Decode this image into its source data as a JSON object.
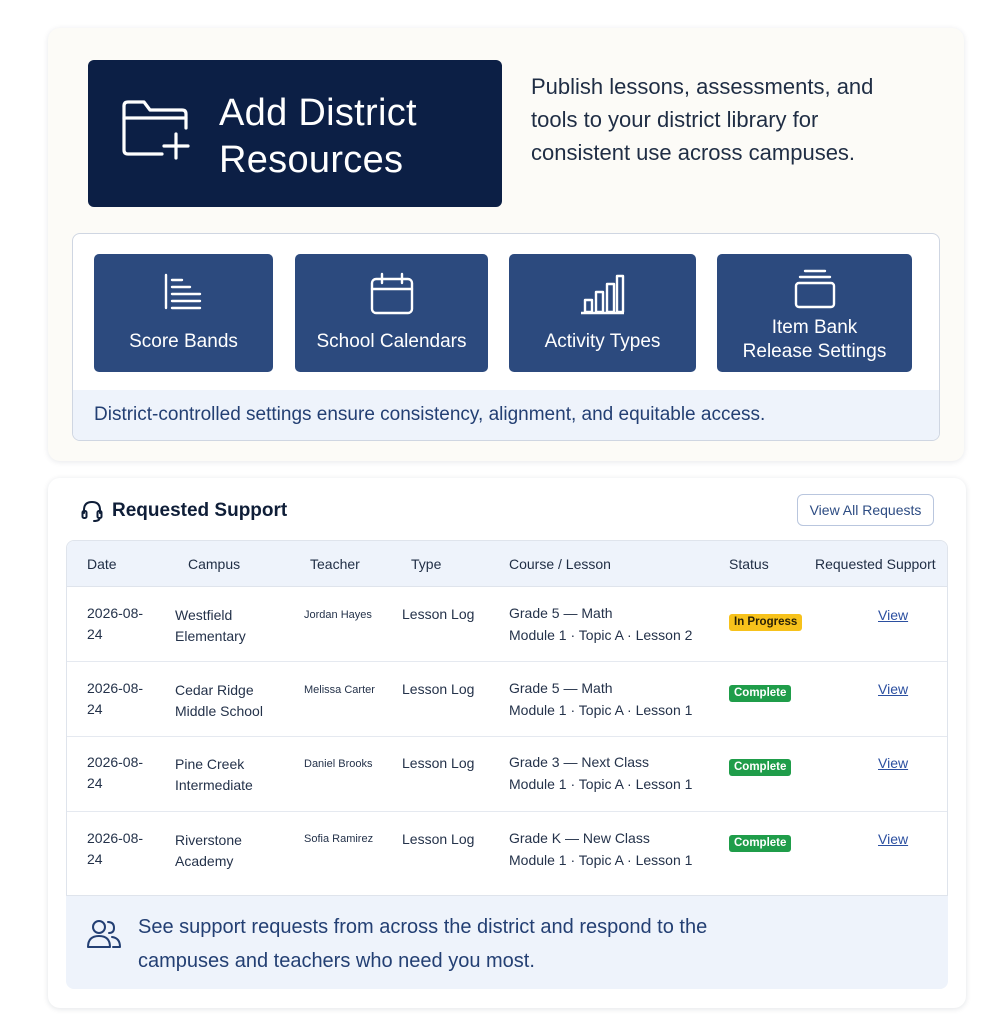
{
  "hero": {
    "title": "Add District Resources",
    "description": "Publish lessons, assessments, and tools to your district library for consistent use across campuses."
  },
  "settings": {
    "tiles": [
      {
        "label": "Score Bands",
        "icon": "list-bars-icon"
      },
      {
        "label": "School Calendars",
        "icon": "calendar-icon"
      },
      {
        "label": "Activity Types",
        "icon": "bar-chart-icon"
      },
      {
        "label": "Item Bank Release Settings",
        "icon": "stack-box-icon"
      }
    ],
    "footer": "District-controlled settings ensure consistency, alignment, and equitable access."
  },
  "support": {
    "title": "Requested Support",
    "view_all_label": "View All Requests",
    "columns": [
      "Date",
      "Campus",
      "Teacher",
      "Type",
      "Course / Lesson",
      "Status",
      "Requested Support"
    ],
    "rows": [
      {
        "date": "2026-08-24",
        "campus": "Westfield Elementary",
        "teacher": "Jordan Hayes",
        "type": "Lesson Log",
        "course": "Grade 5 — Math",
        "lesson": "Module 1 · Topic A · Lesson 2",
        "status": "In Progress",
        "action": "View"
      },
      {
        "date": "2026-08-24",
        "campus": "Cedar Ridge Middle School",
        "teacher": "Melissa Carter",
        "type": "Lesson Log",
        "course": "Grade 5 — Math",
        "lesson": "Module 1 · Topic A · Lesson 1",
        "status": "Complete",
        "action": "View"
      },
      {
        "date": "2026-08-24",
        "campus": "Pine Creek Intermediate",
        "teacher": "Daniel Brooks",
        "type": "Lesson Log",
        "course": "Grade 3 — Next Class",
        "lesson": "Module 1 · Topic A · Lesson 1",
        "status": "Complete",
        "action": "View"
      },
      {
        "date": "2026-08-24",
        "campus": "Riverstone Academy",
        "teacher": "Sofia Ramirez",
        "type": "Lesson Log",
        "course": "Grade K — New Class",
        "lesson": "Module 1 · Topic A · Lesson 1",
        "status": "Complete",
        "action": "View"
      }
    ],
    "footer": "See support requests from across the district and respond to the campuses and teachers who need you most."
  },
  "colors": {
    "navy": "#0c1f45",
    "tile_blue": "#2c4a7e",
    "in_progress": "#f7c21b",
    "complete": "#1f9d4a"
  }
}
